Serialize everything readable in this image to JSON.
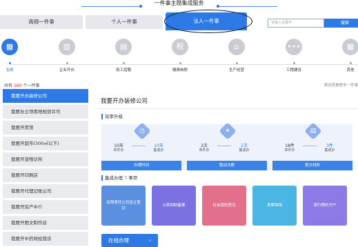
{
  "banner": {
    "title": "一件事主题集成服务"
  },
  "tabs": [
    {
      "label": "高频一件事"
    },
    {
      "label": "个人一件事"
    },
    {
      "label": "法人一件事"
    }
  ],
  "search": {
    "placeholder": "请输入关键字",
    "button": "搜索"
  },
  "categories": [
    {
      "label": "全部",
      "icon": "grid-icon"
    },
    {
      "label": "企业开办",
      "icon": "building-icon"
    },
    {
      "label": "用工招聘",
      "icon": "briefcase-icon"
    },
    {
      "label": "缴费纳税",
      "icon": "tax-icon"
    },
    {
      "label": "生产经营",
      "icon": "factory-icon"
    },
    {
      "label": "工程建设",
      "icon": "dots-icon"
    },
    {
      "label": "其他",
      "icon": "grid-icon"
    }
  ],
  "count": {
    "prefix": "共有",
    "number": "260",
    "suffix": "个一件事"
  },
  "hint": "滚动查看更多一件事",
  "sidebar": {
    "items": [
      {
        "label": "我要开办装修公司"
      },
      {
        "label": "我要办立项用地规划许可"
      },
      {
        "label": "我要开宾馆"
      },
      {
        "label": "我要开超市(300㎡以下)"
      },
      {
        "label": "我要开宠物诊所"
      },
      {
        "label": "我要开印刷店"
      },
      {
        "label": "我要开代理记账公司"
      },
      {
        "label": "我要开房产中介"
      },
      {
        "label": "我要开图文制作店"
      },
      {
        "label": "我要开中药材经营店"
      }
    ]
  },
  "main": {
    "title": "我要开办装修公司",
    "efficiency_label": "效率升级",
    "cards": [
      {
        "before_val": "10天",
        "before_sub": "单件办",
        "after_val": "10天",
        "after_sub": "集成办",
        "foot": "办理时间"
      },
      {
        "before_val": "2次",
        "before_sub": "单件办",
        "after_val": "2次",
        "after_sub": "集成办",
        "foot": "跑动次数"
      },
      {
        "before_val": "18件",
        "before_sub": "单件办",
        "after_val": "3件",
        "after_sub": "集成办",
        "foot": "提交材料"
      }
    ],
    "integrated_prefix": "集成办理",
    "integrated_count": "7",
    "integrated_suffix": "事项",
    "tiles": [
      {
        "label": "有限责任公司设立登记",
        "color": "#5b8fe0"
      },
      {
        "label": "公章刻制备案",
        "color": "#7a72e0"
      },
      {
        "label": "社会保险登记",
        "color": "#e3708a"
      },
      {
        "label": "发票领用",
        "color": "#4bb6e4"
      },
      {
        "label": "银行预约开户",
        "color": "#8d7ae6"
      }
    ],
    "online_button": "在线办理",
    "online_arrow": "›"
  }
}
